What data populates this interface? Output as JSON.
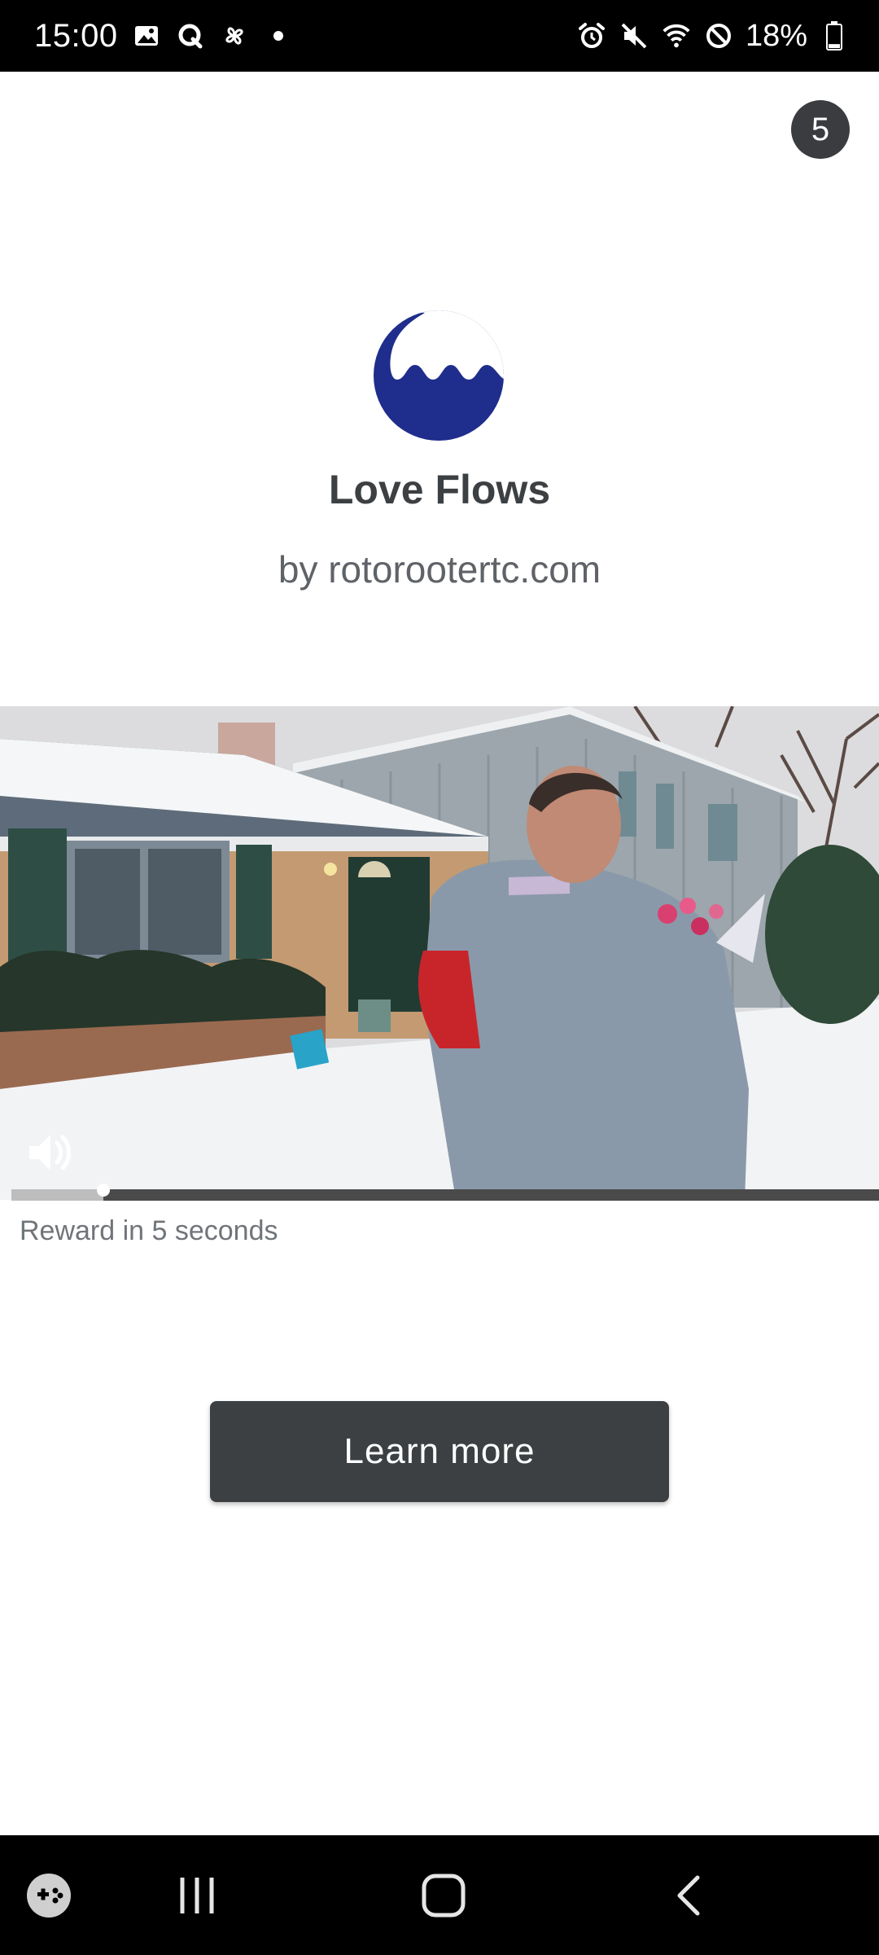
{
  "status_bar": {
    "time": "15:00",
    "left_icons": [
      "gallery-icon",
      "q-icon",
      "pinwheel-icon",
      "dot-icon"
    ],
    "right_icons": [
      "alarm-icon",
      "mute-icon",
      "wifi-icon",
      "do-not-disturb-icon"
    ],
    "battery_text": "18%",
    "battery_level": 0.18
  },
  "ad": {
    "countdown": "5",
    "logo_icon": "wave-logo-icon",
    "title": "Love Flows",
    "by_line": "by rotorootertc.com",
    "video": {
      "progress": 0.106,
      "mute_icon": "speaker-icon"
    },
    "reward_text": "Reward in 5 seconds",
    "cta_label": "Learn more"
  },
  "nav_bar": {
    "items": [
      "game-launcher-icon",
      "recent-apps-icon",
      "home-icon",
      "back-icon"
    ]
  },
  "colors": {
    "logo_blue": "#1f2d8c",
    "button_dark": "#3c4043",
    "status_bar": "#000000"
  }
}
